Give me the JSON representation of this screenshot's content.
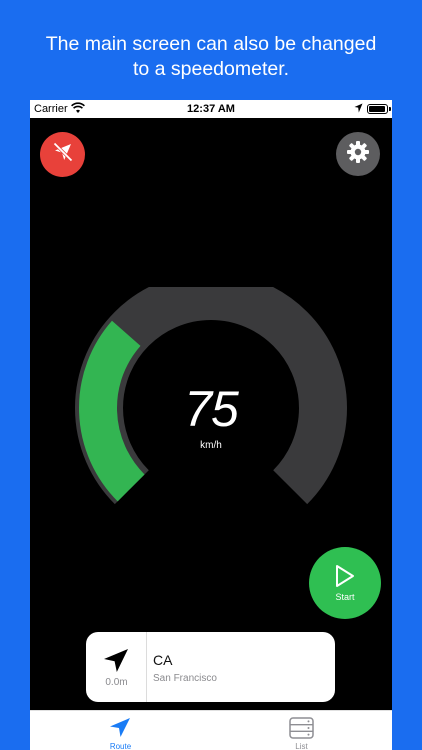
{
  "caption": {
    "line1": "The main screen can also be changed",
    "line2": "to a speedometer."
  },
  "status_bar": {
    "carrier": "Carrier",
    "time": "12:37 AM"
  },
  "speedometer": {
    "speed": "75",
    "unit": "km/h",
    "fill_fraction": 0.32,
    "track_color": "#3a3a3c",
    "fill_color": "#33b552"
  },
  "start_button": {
    "label": "Start",
    "color": "#2fbf52"
  },
  "location_card": {
    "distance": "0.0m",
    "title": "CA",
    "subtitle": "San Francisco"
  },
  "tabs": [
    {
      "label": "Route",
      "icon": "navigation-arrow-icon",
      "active": true
    },
    {
      "label": "List",
      "icon": "server-list-icon",
      "active": false
    }
  ],
  "colors": {
    "background": "#1a6df0",
    "mute_button": "#e8413a",
    "settings_button": "#5d5d5f",
    "active_tab": "#1a7cf5"
  }
}
